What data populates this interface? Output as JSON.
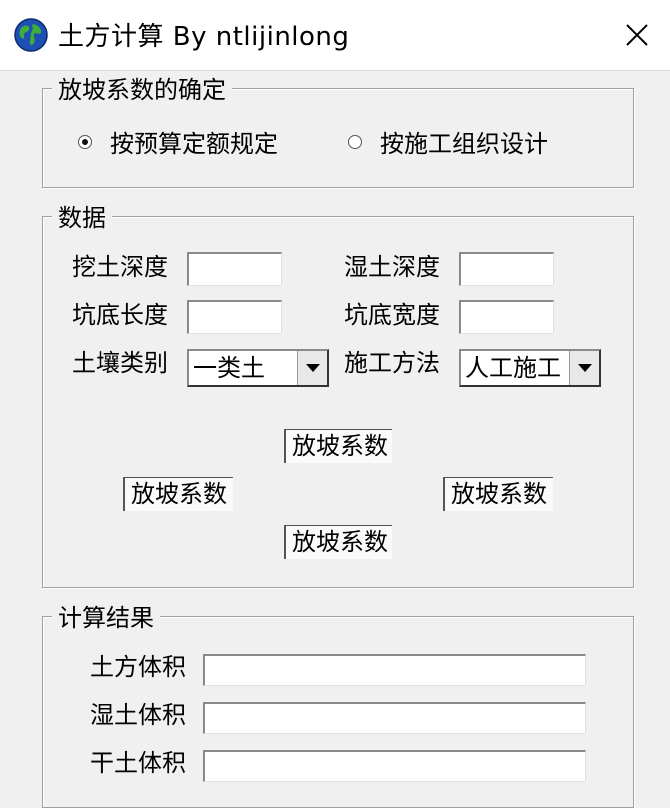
{
  "window": {
    "title": "土方计算 By ntlijinlong"
  },
  "slope_group": {
    "legend": "放坡系数的确定",
    "options": [
      {
        "label": "按预算定额规定",
        "checked": true
      },
      {
        "label": "按施工组织设计",
        "checked": false
      }
    ]
  },
  "data_group": {
    "legend": "数据",
    "dig_depth": {
      "label": "挖土深度",
      "value": ""
    },
    "wet_depth": {
      "label": "湿土深度",
      "value": ""
    },
    "pit_length": {
      "label": "坑底长度",
      "value": ""
    },
    "pit_width": {
      "label": "坑底宽度",
      "value": ""
    },
    "soil_type": {
      "label": "土壤类别",
      "selected": "一类土"
    },
    "method": {
      "label": "施工方法",
      "selected": "人工施工"
    },
    "slope_buttons": [
      "放坡系数",
      "放坡系数",
      "放坡系数",
      "放坡系数"
    ]
  },
  "result_group": {
    "legend": "计算结果",
    "earth_volume": {
      "label": "土方体积",
      "value": ""
    },
    "wet_volume": {
      "label": "湿土体积",
      "value": ""
    },
    "dry_volume": {
      "label": "干土体积",
      "value": ""
    }
  },
  "colors": {
    "background": "#f0f0f0",
    "titlebar": "#ffffff",
    "border": "#a0a0a0"
  },
  "icons": {
    "app": "globe-icon",
    "close": "close-icon"
  }
}
